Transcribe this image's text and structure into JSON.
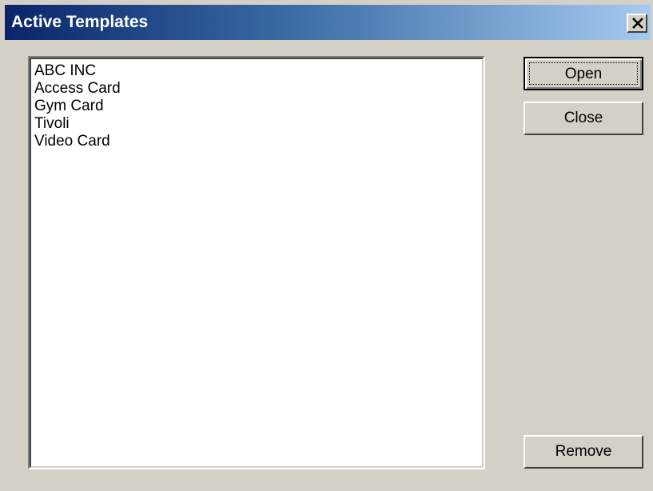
{
  "window": {
    "title": "Active Templates",
    "close_icon": "close-x"
  },
  "templates": {
    "items": [
      "ABC INC",
      "Access Card",
      "Gym Card",
      "Tivoli",
      "Video Card"
    ]
  },
  "buttons": {
    "open_label": "Open",
    "close_label": "Close",
    "remove_label": "Remove"
  },
  "colors": {
    "window_bg": "#d4d0c8",
    "titlebar_start": "#0a246a",
    "titlebar_end": "#a6caf0",
    "title_text": "#ffffff"
  }
}
